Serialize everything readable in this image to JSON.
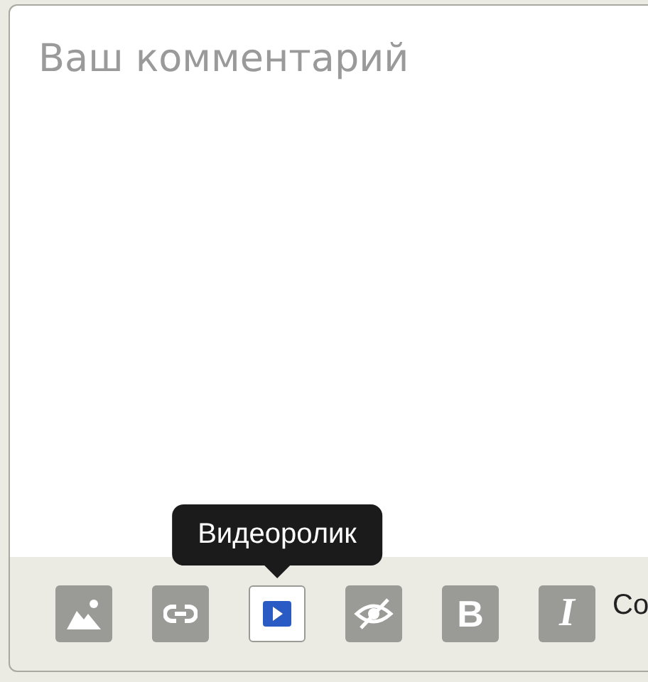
{
  "comment_field": {
    "placeholder": "Ваш комментарий"
  },
  "toolbar": {
    "tools": [
      {
        "kind": "image",
        "selected": false
      },
      {
        "kind": "link",
        "selected": false
      },
      {
        "kind": "video",
        "selected": true,
        "tooltip": "Видеоролик"
      },
      {
        "kind": "hidden",
        "selected": false
      },
      {
        "kind": "bold",
        "label": "B",
        "selected": false
      },
      {
        "kind": "italic",
        "label": "I",
        "selected": false
      }
    ],
    "trailing_text": "Co"
  }
}
